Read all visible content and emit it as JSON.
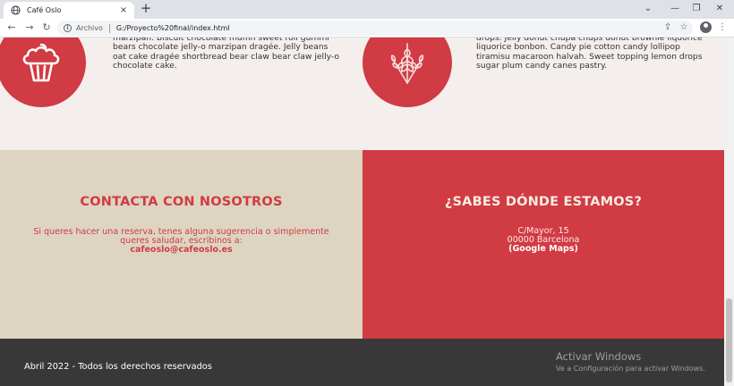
{
  "browser": {
    "tab_title": "Café Oslo",
    "tab_close": "×",
    "new_tab": "+",
    "window_controls": {
      "dropdown": "⌄",
      "minimize": "—",
      "restore": "❐",
      "close": "✕"
    },
    "nav": {
      "back": "←",
      "forward": "→",
      "reload": "↻"
    },
    "omnibox": {
      "scheme_label": "Archivo",
      "url": "G:/Proyecto%20final/index.html"
    },
    "toolbar_icons": {
      "share": "⇪",
      "bookmark": "☆",
      "menu": "⋮"
    }
  },
  "features": {
    "left_text": "marzipan. Biscuit chocolate muffin sweet roll gummi bears chocolate jelly-o marzipan dragée. Jelly beans oat cake dragée shortbread bear claw bear claw jelly-o chocolate cake.",
    "right_text": "drops. Jelly donut chupa chups donut brownie liquorice liquorice bonbon. Candy pie cotton candy lollipop tiramisu macaroon halvah. Sweet topping lemon drops sugar plum candy canes pastry.",
    "left_icon": "cupcake-icon",
    "right_icon": "wheat-icon"
  },
  "contact": {
    "title": "CONTACTA CON NOSOTROS",
    "message": "Si queres hacer una reserva, tenes alguna sugerencia o simplemente queres saludar, escribinos a:",
    "email": "cafeoslo@cafeoslo.es"
  },
  "location": {
    "title": "¿SABES DÓNDE ESTAMOS?",
    "street": "C/Mayor, 15",
    "city": "00000 Barcelona",
    "maps_link": "(Google Maps)"
  },
  "footer": {
    "copyright": "Abril 2022 - Todos los derechos reservados"
  },
  "windows_watermark": {
    "title": "Activar Windows",
    "subtitle": "Ve a Configuración para activar Windows."
  },
  "colors": {
    "brand_red": "#d13b43",
    "beige": "#ddd5c2",
    "page_bg": "#f4efec",
    "footer_bg": "#383838"
  }
}
